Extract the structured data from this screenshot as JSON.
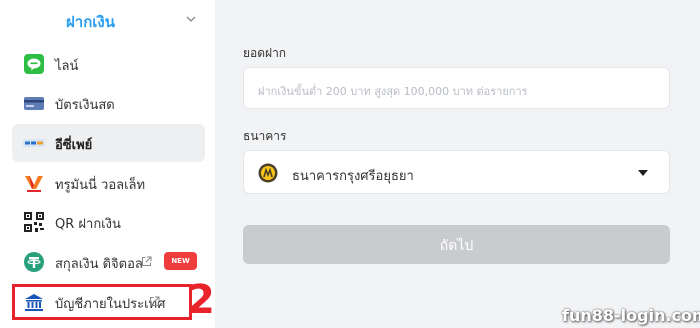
{
  "sidebar": {
    "title": "ฝากเงิน",
    "items": [
      {
        "label": "ไลน์",
        "icon": "line-icon"
      },
      {
        "label": "บัตรเงินสด",
        "icon": "cash-card-icon"
      },
      {
        "label": "อีซี่เพย์",
        "icon": "easypay-icon"
      },
      {
        "label": "ทรูมันนี่ วอลเล็ท",
        "icon": "truemoney-icon"
      },
      {
        "label": "QR ฝากเงิน",
        "icon": "qr-code-icon"
      },
      {
        "label": "สกุลเงิน ดิจิตอล",
        "icon": "tether-icon",
        "badge": "NEW"
      },
      {
        "label": "บัญชีภายในประเทศ",
        "icon": "bank-icon"
      }
    ]
  },
  "form": {
    "amount_label": "ยอดฝาก",
    "amount_placeholder": "ฝากเงินขั้นต่ำ 200 บาท สูงสุด 100,000 บาท ต่อรายการ",
    "bank_label": "ธนาคาร",
    "bank_value": "ธนาคารกรุงศรีอยุธยา",
    "submit_label": "ถัดไป"
  },
  "annotation": {
    "step_number": "2"
  },
  "watermark": "fun88-login.com",
  "colors": {
    "accent": "#2c9ef0",
    "highlight": "#e8242a",
    "badge": "#ef3d3d",
    "panel_bg": "#f2f3f5",
    "button_disabled": "#c9cbcf"
  }
}
